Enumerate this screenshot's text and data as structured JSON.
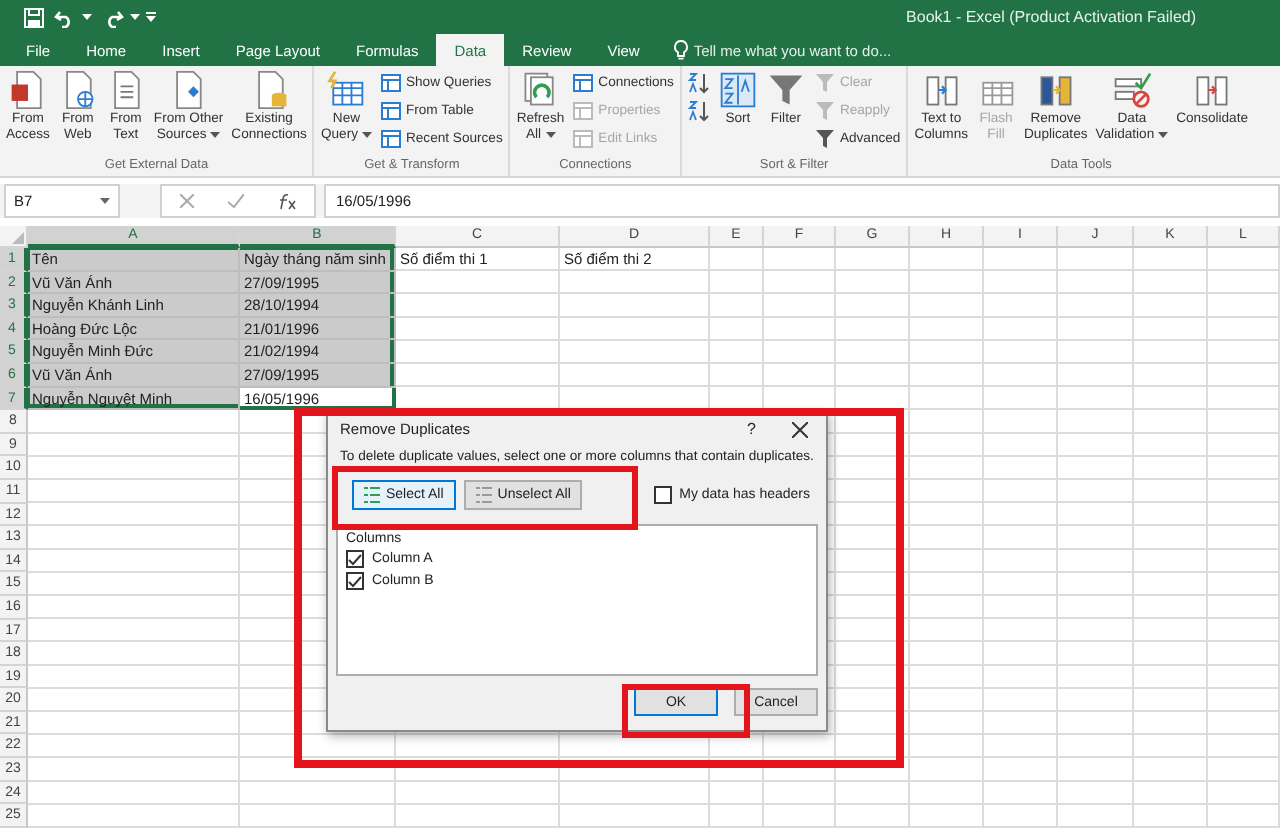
{
  "window": {
    "title": "Book1 - Excel (Product Activation Failed)"
  },
  "tabs": [
    {
      "label": "File",
      "selected": false
    },
    {
      "label": "Home",
      "selected": false
    },
    {
      "label": "Insert",
      "selected": false
    },
    {
      "label": "Page Layout",
      "selected": false
    },
    {
      "label": "Formulas",
      "selected": false
    },
    {
      "label": "Data",
      "selected": true
    },
    {
      "label": "Review",
      "selected": false
    },
    {
      "label": "View",
      "selected": false
    }
  ],
  "tell_me": {
    "placeholder": "Tell me what you want to do..."
  },
  "ribbon": [
    {
      "label": "Get External Data",
      "items": [
        {
          "kind": "large",
          "label": "From\nAccess",
          "disabled": false
        },
        {
          "kind": "large",
          "label": "From\nWeb",
          "disabled": false
        },
        {
          "kind": "large",
          "label": "From\nText",
          "disabled": false
        },
        {
          "kind": "large",
          "label": "From Other\nSources",
          "dropdown": true,
          "disabled": false
        },
        {
          "kind": "large",
          "label": "Existing\nConnections",
          "disabled": false
        }
      ]
    },
    {
      "label": "Get & Transform",
      "items": [
        {
          "kind": "large",
          "label": "New\nQuery",
          "dropdown": true,
          "disabled": false
        },
        {
          "kind": "stack",
          "items": [
            {
              "label": "Show Queries",
              "disabled": false
            },
            {
              "label": "From Table",
              "disabled": false
            },
            {
              "label": "Recent Sources",
              "disabled": false
            }
          ]
        }
      ]
    },
    {
      "label": "Connections",
      "items": [
        {
          "kind": "large",
          "label": "Refresh\nAll",
          "dropdown": true,
          "disabled": false
        },
        {
          "kind": "stack",
          "items": [
            {
              "label": "Connections",
              "disabled": false
            },
            {
              "label": "Properties",
              "disabled": true
            },
            {
              "label": "Edit Links",
              "disabled": true
            }
          ]
        }
      ]
    },
    {
      "label": "Sort & Filter",
      "items": [
        {
          "kind": "stack",
          "items": [
            {
              "disabled": false
            },
            {
              "disabled": false
            }
          ]
        },
        {
          "kind": "large",
          "label": "Sort",
          "disabled": false
        },
        {
          "kind": "large",
          "label": "Filter",
          "disabled": false
        },
        {
          "kind": "stack",
          "items": [
            {
              "label": "Clear",
              "disabled": true
            },
            {
              "label": "Reapply",
              "disabled": true
            },
            {
              "label": "Advanced",
              "disabled": false
            }
          ]
        }
      ]
    },
    {
      "label": "Data Tools",
      "items": [
        {
          "kind": "large",
          "label": "Text to\nColumns",
          "disabled": false
        },
        {
          "kind": "large",
          "label": "Flash\nFill",
          "disabled": true
        },
        {
          "kind": "large",
          "label": "Remove\nDuplicates",
          "disabled": false
        },
        {
          "kind": "large",
          "label": "Data\nValidation",
          "dropdown": true,
          "disabled": false
        },
        {
          "kind": "large",
          "label": "Consolidate",
          "disabled": false
        }
      ]
    }
  ],
  "formula_bar": {
    "name_box": "B7",
    "value": "16/05/1996"
  },
  "sheet": {
    "columns": [
      {
        "label": "A",
        "selected": true
      },
      {
        "label": "B",
        "selected": true
      },
      {
        "label": "C",
        "selected": false
      },
      {
        "label": "D",
        "selected": false
      },
      {
        "label": "E",
        "selected": false
      },
      {
        "label": "F",
        "selected": false
      },
      {
        "label": "G",
        "selected": false
      },
      {
        "label": "H",
        "selected": false
      },
      {
        "label": "I",
        "selected": false
      },
      {
        "label": "J",
        "selected": false
      },
      {
        "label": "K",
        "selected": false
      },
      {
        "label": "L",
        "selected": false
      }
    ],
    "rows": [
      {
        "number": "1",
        "cells": [
          {
            "text": "Tên",
            "selected": true
          },
          {
            "text": "Ngày tháng năm sinh",
            "selected": true
          },
          {
            "text": "Số điểm thi 1",
            "selected": false
          },
          {
            "text": "Số điểm thi 2",
            "selected": false
          }
        ]
      },
      {
        "number": "2",
        "cells": [
          {
            "text": "Vũ Văn Ánh",
            "selected": true
          },
          {
            "text": "27/09/1995",
            "selected": true
          }
        ]
      },
      {
        "number": "3",
        "cells": [
          {
            "text": "Nguyễn Khánh Linh",
            "selected": true
          },
          {
            "text": "28/10/1994",
            "selected": true
          }
        ]
      },
      {
        "number": "4",
        "cells": [
          {
            "text": "Hoàng Đức Lộc",
            "selected": true
          },
          {
            "text": "21/01/1996",
            "selected": true
          }
        ]
      },
      {
        "number": "5",
        "cells": [
          {
            "text": "Nguyễn Minh Đức",
            "selected": true
          },
          {
            "text": "21/02/1994",
            "selected": true
          }
        ]
      },
      {
        "number": "6",
        "cells": [
          {
            "text": "Vũ Văn Ánh",
            "selected": true
          },
          {
            "text": "27/09/1995",
            "selected": true
          }
        ]
      },
      {
        "number": "7",
        "cells": [
          {
            "text": "Nguyễn Nguyệt Minh",
            "selected": true
          },
          {
            "text": "16/05/1996",
            "selected": true,
            "active": true
          }
        ]
      },
      {
        "number": "8"
      },
      {
        "number": "9"
      },
      {
        "number": "10"
      },
      {
        "number": "11"
      },
      {
        "number": "12"
      },
      {
        "number": "13"
      },
      {
        "number": "14"
      },
      {
        "number": "15"
      },
      {
        "number": "16"
      },
      {
        "number": "17"
      },
      {
        "number": "18"
      },
      {
        "number": "19"
      },
      {
        "number": "20"
      },
      {
        "number": "21"
      },
      {
        "number": "22"
      },
      {
        "number": "23"
      },
      {
        "number": "24"
      },
      {
        "number": "25"
      }
    ]
  },
  "dialog": {
    "title": "Remove Duplicates",
    "help": "?",
    "instruction": "To delete duplicate values, select one or more columns that contain duplicates.",
    "buttons": [
      {
        "label": "Select All",
        "focused": true
      },
      {
        "label": "Unselect All",
        "focused": false
      }
    ],
    "headers_checkbox": {
      "label": "My data has headers",
      "checked": false
    },
    "list_title": "Columns",
    "columns": [
      {
        "label": "Column A",
        "checked": true
      },
      {
        "label": "Column B",
        "checked": true
      }
    ],
    "actions": [
      {
        "label": "OK",
        "default": true
      },
      {
        "label": "Cancel",
        "default": false
      }
    ]
  }
}
